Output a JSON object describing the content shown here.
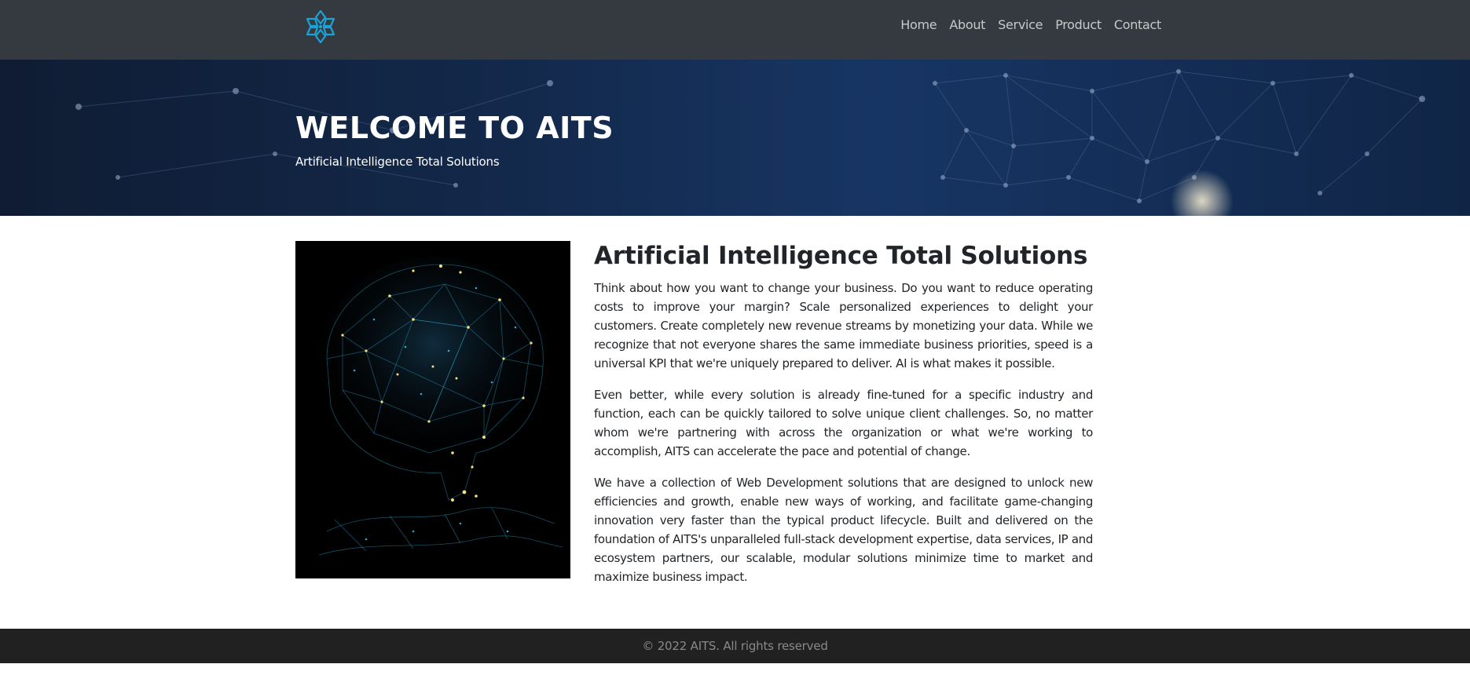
{
  "nav": {
    "logo_icon": "flower-logo-icon",
    "links": [
      "Home",
      "About",
      "Service",
      "Product",
      "Contact"
    ]
  },
  "hero": {
    "title": "WELCOME TO AITS",
    "subtitle": "Artificial Intelligence Total Solutions"
  },
  "main": {
    "image_icon": "ai-brain-network-image",
    "heading": "Artificial Intelligence Total Solutions",
    "paragraphs": [
      "Think about how you want to change your business. Do you want to reduce operating costs to improve your margin? Scale personalized experiences to delight your customers. Create completely new revenue streams by monetizing your data. While we recognize that not everyone shares the same immediate business priorities, speed is a universal KPI that we're uniquely prepared to deliver. AI is what makes it possible.",
      "Even better, while every solution is already fine-tuned for a specific industry and function, each can be quickly tailored to solve unique client challenges. So, no matter whom we're partnering with across the organization or what we're working to accomplish, AITS can accelerate the pace and potential of change.",
      "We have a collection of Web Development solutions that are designed to unlock new efficiencies and growth, enable new ways of working, and facilitate game-changing innovation very faster than the typical product lifecycle. Built and delivered on the foundation of AITS's unparalleled full-stack development expertise, data services, IP and ecosystem partners, our scalable, modular solutions minimize time to market and maximize business impact."
    ]
  },
  "footer": {
    "copyright": "© 2022 AITS. All rights reserved"
  },
  "colors": {
    "navbar_bg": "#343a40",
    "hero_bg": "#13294b",
    "logo_accent": "#1ba3d6",
    "footer_bg": "#212121"
  }
}
